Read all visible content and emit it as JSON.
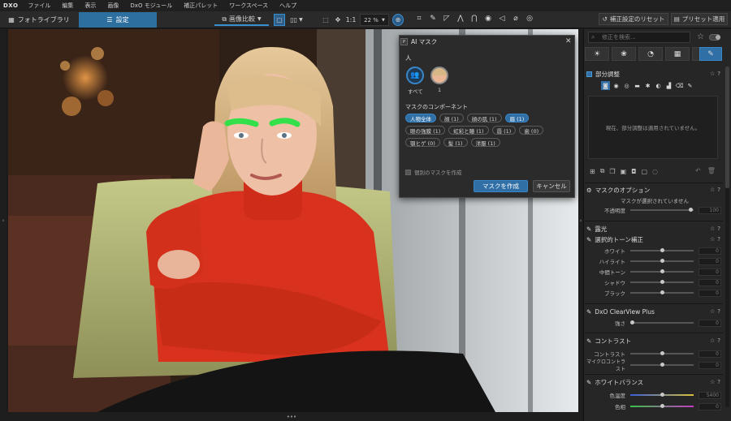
{
  "menu": {
    "logo": "DXO",
    "items": [
      "ファイル",
      "編集",
      "表示",
      "画像",
      "DxO モジュール",
      "補正パレット",
      "ワークスペース",
      "ヘルプ"
    ]
  },
  "toolbar": {
    "library_tab": "フォトライブラリ",
    "settings_tab": "設定",
    "compare_label": "画像比較",
    "zoom_fit": "1:1",
    "zoom_value": "22 %",
    "reset_label": "補正設定のリセット",
    "apply_preset_label": "プリセット適用"
  },
  "panel": {
    "search_placeholder": "修正を検索...",
    "local_adjust_title": "部分調整",
    "local_adjust_empty": "現在、部分調整は適用されていません。",
    "mask_options_title": "マスクのオプション",
    "mask_none_selected": "マスクが選択されていません",
    "opacity_label": "不透明度",
    "opacity_value": "100",
    "exposure_title": "露光",
    "selective_tone_title": "選択的トーン補正",
    "selective_tone_rows": [
      {
        "label": "ホワイト",
        "value": "0"
      },
      {
        "label": "ハイライト",
        "value": "0"
      },
      {
        "label": "中間トーン",
        "value": "0"
      },
      {
        "label": "シャドウ",
        "value": "0"
      },
      {
        "label": "ブラック",
        "value": "0"
      }
    ],
    "clearview_title": "DxO ClearView Plus",
    "clearview_row": {
      "label": "強さ",
      "value": "0"
    },
    "contrast_title": "コントラスト",
    "contrast_rows": [
      {
        "label": "コントラスト",
        "value": "0"
      },
      {
        "label": "マイクロコントラスト",
        "value": "0"
      }
    ],
    "whitebalance_title": "ホワイトバランス",
    "whitebalance_rows": [
      {
        "label": "色温度",
        "value": "5400"
      },
      {
        "label": "色相",
        "value": "0"
      }
    ]
  },
  "dialog": {
    "title": "AI マスク",
    "people_label": "人",
    "person_all_label": "すべて",
    "person_1_label": "1",
    "components_label": "マスクのコンポーネント",
    "chips": [
      {
        "label": "人物全体",
        "on": true
      },
      {
        "label": "顔 (1)",
        "on": false
      },
      {
        "label": "顔の肌 (1)",
        "on": false
      },
      {
        "label": "眉 (1)",
        "on": true
      },
      {
        "label": "眼の強膜 (1)",
        "on": false
      },
      {
        "label": "虹彩と瞳 (1)",
        "on": false
      },
      {
        "label": "唇 (1)",
        "on": false
      },
      {
        "label": "歯 (0)",
        "on": false
      },
      {
        "label": "顎ヒゲ (0)",
        "on": false
      },
      {
        "label": "髪 (1)",
        "on": false
      },
      {
        "label": "洋服 (1)",
        "on": false
      }
    ],
    "separate_mask_label": "個別のマスクを作成",
    "create_button": "マスクを作成",
    "cancel_button": "キャンセル"
  }
}
